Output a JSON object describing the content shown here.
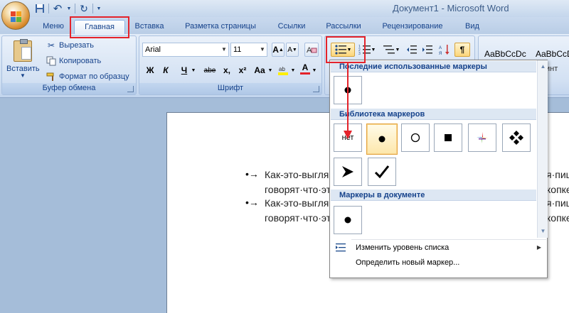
{
  "window": {
    "title": "Документ1 - Microsoft Word"
  },
  "quick_access": {
    "save_icon": "save-icon",
    "undo_icon": "undo-icon",
    "redo_icon": "redo-icon",
    "customize_icon": "customize-arrow-icon"
  },
  "tabs": [
    {
      "label": "Меню"
    },
    {
      "label": "Главная",
      "active": true
    },
    {
      "label": "Вставка"
    },
    {
      "label": "Разметка страницы"
    },
    {
      "label": "Ссылки"
    },
    {
      "label": "Рассылки"
    },
    {
      "label": "Рецензирование"
    },
    {
      "label": "Вид"
    }
  ],
  "clipboard": {
    "group_label": "Буфер обмена",
    "paste_label": "Вставить",
    "cut_label": "Вырезать",
    "copy_label": "Копировать",
    "format_painter_label": "Формат по образцу"
  },
  "font": {
    "group_label": "Шрифт",
    "font_name": "Arial",
    "font_size": "11",
    "grow_label": "A",
    "shrink_label": "A",
    "bold_label": "Ж",
    "italic_label": "К",
    "underline_label": "Ч",
    "strike_label": "abe",
    "subscript_label": "x,",
    "superscript_label": "x²",
    "case_label": "Aa",
    "color_label": "A"
  },
  "styles": {
    "sample_1": "AaBbCcDc",
    "sample_2": "AaBbCcDc",
    "sample_3": "ез инт"
  },
  "document": {
    "lines": [
      {
        "bullet": "•→",
        "left": "Как-это-выгля",
        "right": "я·пиш"
      },
      {
        "bullet": "",
        "left": "говорят·что·эт",
        "right": "копке"
      },
      {
        "bullet": "•→",
        "left": "Как-это-выгля",
        "right": "я·пиш"
      },
      {
        "bullet": "",
        "left": "говорят·что·эт",
        "right": "копке"
      }
    ]
  },
  "bullet_panel": {
    "recent_header": "Последние использованные маркеры",
    "library_header": "Библиотека маркеров",
    "document_header": "Маркеры в документе",
    "none_label": "нет",
    "menu": {
      "change_level": "Изменить уровень списка",
      "define_new": "Определить новый маркер..."
    }
  },
  "colors": {
    "highlight": "#e4232b",
    "accent": "#15428b",
    "selected_border": "#e3a33d"
  }
}
